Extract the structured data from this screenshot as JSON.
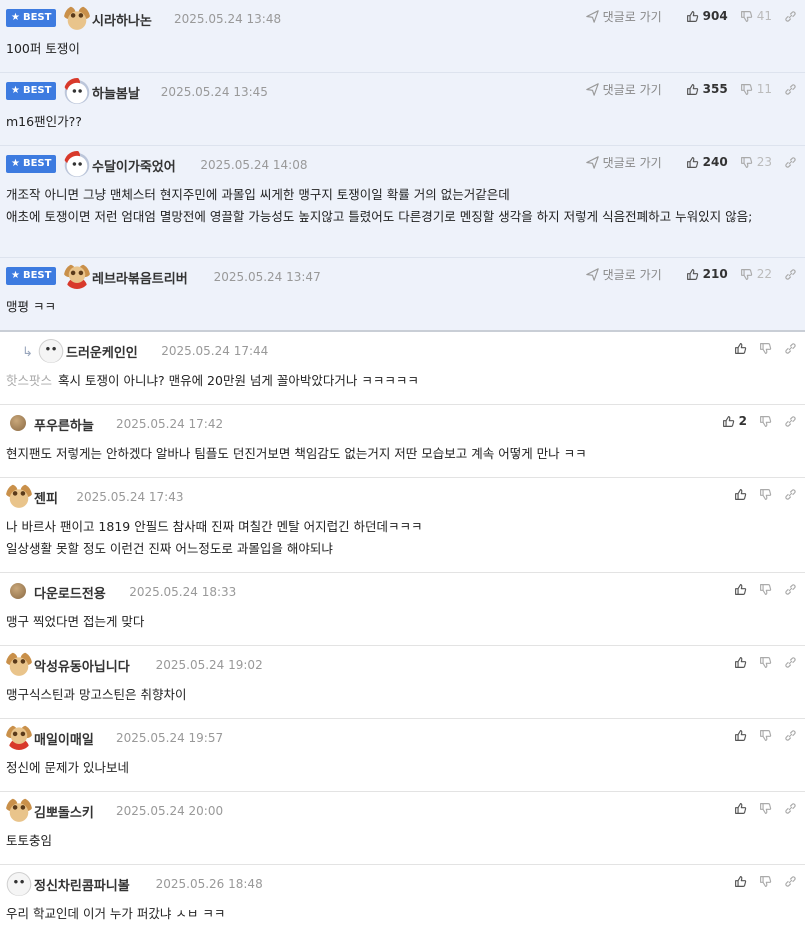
{
  "labels": {
    "best": "BEST",
    "goto": "댓글로 가기"
  },
  "comments": [
    {
      "best": true,
      "avatar": "dog",
      "nickname": "시라하나논",
      "date": "2025.05.24 13:48",
      "up": "904",
      "down": "41",
      "lines": [
        "100퍼 토쟁이"
      ]
    },
    {
      "best": true,
      "avatar": "santa",
      "nickname": "하늘봄날",
      "date": "2025.05.24 13:45",
      "up": "355",
      "down": "11",
      "lines": [
        "m16팬인가??"
      ]
    },
    {
      "best": true,
      "avatar": "santa",
      "nickname": "수달이가죽었어",
      "date": "2025.05.24 14:08",
      "up": "240",
      "down": "23",
      "lines": [
        "개조작 아니면 그냥 맨체스터 현지주민에 과몰입 씨게한 맹구지 토쟁이일 확률 거의 없는거같은데",
        "애초에 토쟁이면 저런 엄대엄 멸망전에 영끌할 가능성도 높지않고 틀렸어도 다른경기로 멘징할 생각을 하지 저렇게 식음전폐하고 누워있지 않음;"
      ]
    },
    {
      "best": true,
      "avatar": "dogred",
      "nickname": "레브라볶음트리버",
      "date": "2025.05.24 13:47",
      "up": "210",
      "down": "22",
      "lines": [
        "맹평 ㅋㅋ"
      ]
    },
    {
      "best": false,
      "reply": true,
      "avatar": "white",
      "nickname": "드러운케인인",
      "date": "2025.05.24 17:44",
      "up": "",
      "down": "",
      "quote": "핫스팟스",
      "lines": [
        "혹시 토쟁이 아니냐? 맨유에 20만원 넘게 꼴아박았다거나 ㅋㅋㅋㅋㅋ"
      ]
    },
    {
      "best": false,
      "avatar": "ball",
      "nickname": "푸우른하늘",
      "date": "2025.05.24 17:42",
      "up": "2",
      "down": "",
      "lines": [
        "현지팬도 저렇게는 안하겠다 알바나 팀플도 던진거보면 책임감도 없는거지 저딴 모습보고 계속 어떻게 만나 ㅋㅋ"
      ]
    },
    {
      "best": false,
      "avatar": "dog",
      "nickname": "젠피",
      "date": "2025.05.24 17:43",
      "up": "",
      "down": "",
      "lines": [
        "나 바르사 팬이고 1819 안필드 참사때 진짜 며칠간 멘탈 어지럽긴 하던데ㅋㅋㅋ",
        "일상생활 못할 정도 이런건 진짜 어느정도로 과몰입을 해야되냐"
      ]
    },
    {
      "best": false,
      "avatar": "ball",
      "nickname": "다운로드전용",
      "date": "2025.05.24 18:33",
      "up": "",
      "down": "",
      "lines": [
        "맹구 찍었다면 접는게 맞다"
      ]
    },
    {
      "best": false,
      "avatar": "dog",
      "nickname": "악성유동아닙니다",
      "date": "2025.05.24 19:02",
      "up": "",
      "down": "",
      "lines": [
        "맹구식스틴과 망고스틴은 취향차이"
      ]
    },
    {
      "best": false,
      "avatar": "dogred",
      "nickname": "매일이매일",
      "date": "2025.05.24 19:57",
      "up": "",
      "down": "",
      "lines": [
        "정신에 문제가 있나보네"
      ]
    },
    {
      "best": false,
      "avatar": "dog",
      "nickname": "김뽀돌스키",
      "date": "2025.05.24 20:00",
      "up": "",
      "down": "",
      "lines": [
        "토토충임"
      ]
    },
    {
      "best": false,
      "avatar": "white",
      "nickname": "정신차린콤파니볼",
      "date": "2025.05.26 18:48",
      "up": "",
      "down": "",
      "lines": [
        "우리 학교인데 이거 누가 퍼갔냐 ㅅㅂ ㅋㅋ"
      ]
    }
  ],
  "colors": {
    "best_bg": "#eef2fa",
    "badge": "#3d7be0"
  }
}
